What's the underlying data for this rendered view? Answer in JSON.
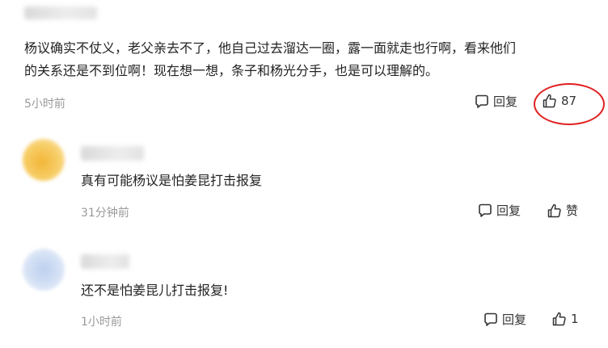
{
  "comments": [
    {
      "text_line1": "杨议确实不仗义，老父亲去不了，他自己过去溜达一圈，露一面就走也行啊，看来他们",
      "text_line2": "的关系还是不到位啊！现在想一想，条子和杨光分手，也是可以理解的。",
      "time": "5小时前",
      "reply_label": "回复",
      "like_label": "87"
    },
    {
      "text": "真有可能杨议是怕姜昆打击报复",
      "time": "31分钟前",
      "reply_label": "回复",
      "like_label": "赞"
    },
    {
      "text": "还不是怕姜昆儿打击报复!",
      "time": "1小时前",
      "reply_label": "回复",
      "like_label": "1"
    }
  ],
  "colors": {
    "annotation_circle": "#e02020",
    "avatar_2": "#f2b638",
    "avatar_3": "#bcd0ee"
  }
}
